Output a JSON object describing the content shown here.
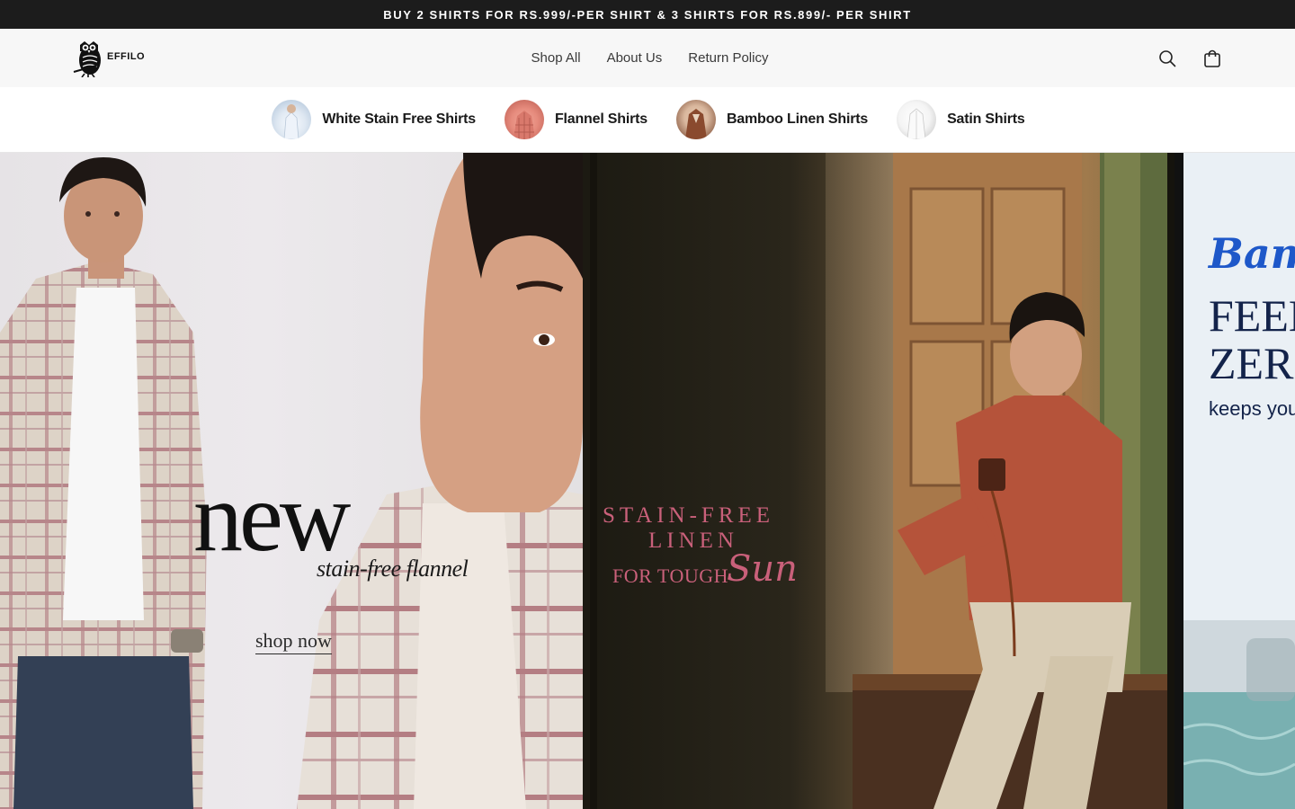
{
  "announcement": {
    "text": "BUY 2 SHIRTS FOR RS.999/-PER SHIRT & 3 SHIRTS FOR RS.899/- PER SHIRT"
  },
  "header": {
    "logo_text": "EFFILO",
    "nav": [
      {
        "label": "Shop All"
      },
      {
        "label": "About Us"
      },
      {
        "label": "Return Policy"
      }
    ],
    "icons": [
      "search-icon",
      "cart-icon"
    ]
  },
  "categories": [
    {
      "label": "White Stain Free Shirts",
      "thumb_colors": [
        "#dfe8f2",
        "#a9bfd6"
      ]
    },
    {
      "label": "Flannel Shirts",
      "thumb_colors": [
        "#e68b7d",
        "#b7574c"
      ]
    },
    {
      "label": "Bamboo Linen Shirts",
      "thumb_colors": [
        "#d9b79d",
        "#6d3a24"
      ]
    },
    {
      "label": "Satin Shirts",
      "thumb_colors": [
        "#f4f4f4",
        "#bfbfbf"
      ]
    }
  ],
  "hero": {
    "slide1": {
      "headline": "new",
      "subline": "stain-free flannel",
      "cta": "shop now"
    },
    "slide2": {
      "line1": "STAIN-FREE",
      "line2": "LINEN",
      "line3": "FOR TOUGH",
      "script": "Sun"
    },
    "slide3": {
      "script": "Bamb",
      "line1": "FEEL",
      "line2": "ZERO",
      "line3": "keeps you"
    }
  },
  "colors": {
    "announcement_bg": "#1c1c1c",
    "header_bg": "#f7f7f7",
    "accent_pink": "#c9607a",
    "accent_blue": "#1e58c9"
  }
}
